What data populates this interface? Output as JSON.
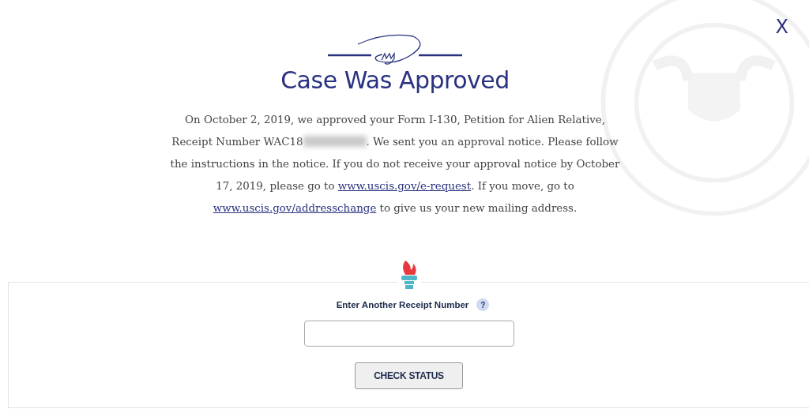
{
  "close_button": "X",
  "title": "Case Was Approved",
  "message": [
    {
      "kind": "text",
      "text": "On October 2, 2019, we approved your Form I-130, Petition for Alien Relative, Receipt Number WAC18"
    },
    {
      "kind": "redacted"
    },
    {
      "kind": "text",
      "text": ". We sent you an approval notice. Please follow the instructions in the notice. If you do not receive your approval notice by October 17, 2019, please go to "
    },
    {
      "kind": "link",
      "text": "www.uscis.gov/e-request"
    },
    {
      "kind": "text",
      "text": ". If you move, go to "
    },
    {
      "kind": "link",
      "text": "www.uscis.gov/addresschange"
    },
    {
      "kind": "text",
      "text": " to give us your new mailing address."
    }
  ],
  "form": {
    "label": "Enter Another Receipt Number",
    "help": "?",
    "button": "CHECK STATUS"
  }
}
